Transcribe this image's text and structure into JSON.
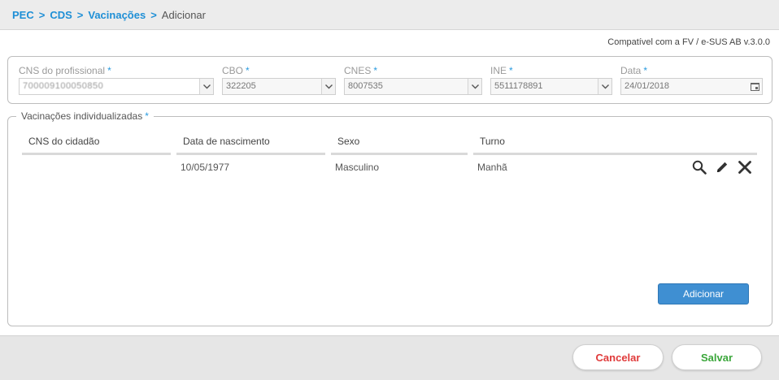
{
  "breadcrumb": {
    "items": [
      "PEC",
      "CDS",
      "Vacinações"
    ],
    "separator": ">",
    "current": "Adicionar"
  },
  "compat_note": "Compatível com a FV / e-SUS AB v.3.0.0",
  "required_marker": "*",
  "header_fields": {
    "cns_profissional": {
      "label": "CNS do profissional",
      "value": "700009100050850"
    },
    "cbo": {
      "label": "CBO",
      "value": "322205"
    },
    "cnes": {
      "label": "CNES",
      "value": "8007535"
    },
    "ine": {
      "label": "INE",
      "value": "5511178891"
    },
    "data": {
      "label": "Data",
      "value": "24/01/2018"
    }
  },
  "vaccinations": {
    "legend": "Vacinações individualizadas",
    "columns": [
      "CNS do cidadão",
      "Data de nascimento",
      "Sexo",
      "Turno"
    ],
    "rows": [
      {
        "cns": "",
        "data_nascimento": "10/05/1977",
        "sexo": "Masculino",
        "turno": "Manhã"
      }
    ],
    "add_button": "Adicionar"
  },
  "footer": {
    "cancel_label": "Cancelar",
    "save_label": "Salvar"
  },
  "icons": {
    "row_view": "search-icon",
    "row_edit": "pencil-icon",
    "row_delete": "close-icon",
    "dropdown": "chevron-down-icon",
    "calendar": "calendar-icon"
  },
  "colors": {
    "accent_blue": "#1e8fd6",
    "required_blue": "#2a9bdf",
    "add_button": "#3f8fd2",
    "cancel_red": "#e03a3a",
    "save_green": "#3aa63a"
  }
}
